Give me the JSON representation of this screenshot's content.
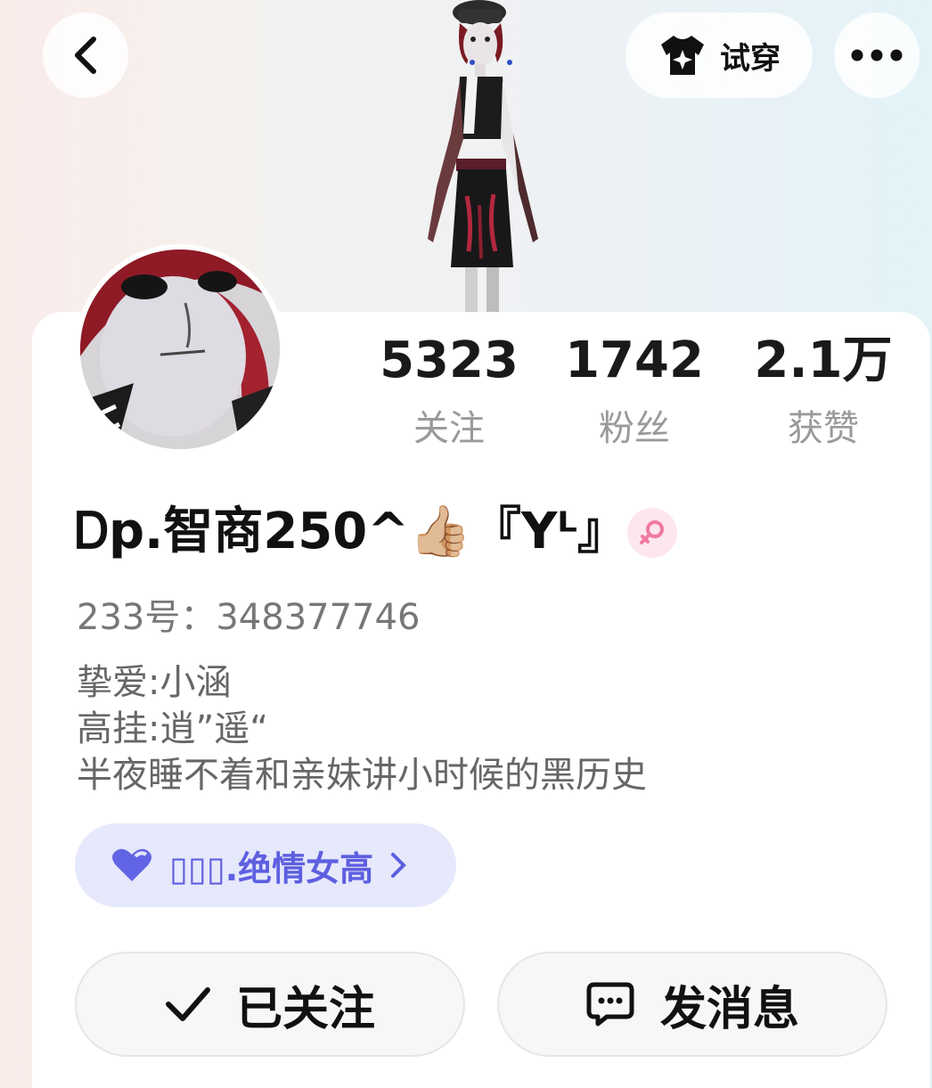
{
  "header": {
    "back_icon": "chevron-left-icon",
    "tryon_icon": "shirt-sparkle-icon",
    "tryon_label": "试穿",
    "more_icon": "more-dots-icon"
  },
  "profile": {
    "username": "Ꭰp.智商250^👍🏼『Yᴸ』",
    "gender_icon": "female-icon",
    "user_id": "233号：348377746",
    "bio": [
      "挚爱:小涵",
      "高挂:逍”遥“",
      "半夜睡不着和亲妹讲小时候的黑历史"
    ]
  },
  "stats": [
    {
      "value": "5323",
      "label": "关注"
    },
    {
      "value": "1742",
      "label": "粉丝"
    },
    {
      "value": "2.1万",
      "label": "获赞"
    }
  ],
  "group": {
    "icon": "heart-icon",
    "label": "▯▯▯.绝情女高",
    "chevron": "chevron-right-icon"
  },
  "actions": {
    "follow_label": "已关注",
    "follow_icon": "check-icon",
    "message_label": "发消息",
    "message_icon": "chat-bubble-icon"
  },
  "colors": {
    "accent": "#5d5fe0",
    "group_bg": "#e6e8fb",
    "gender_pink": "#f07aa0"
  }
}
